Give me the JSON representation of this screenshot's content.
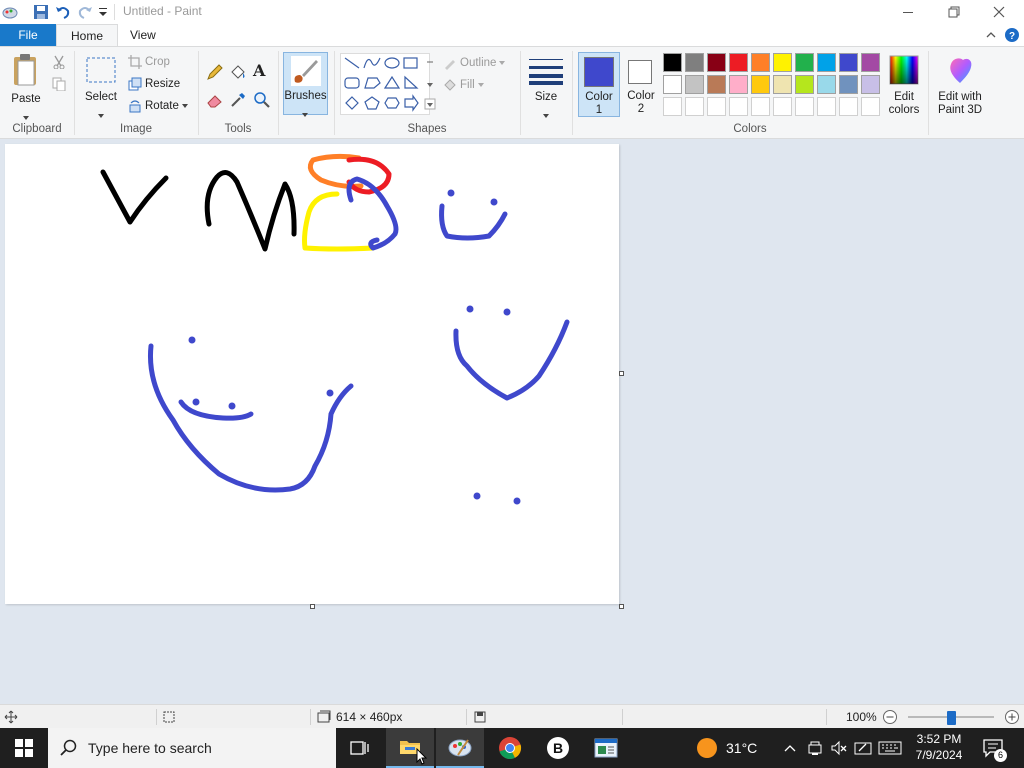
{
  "app": {
    "title": "Untitled - Paint"
  },
  "menu": {
    "file": "File",
    "home": "Home",
    "view": "View"
  },
  "ribbon": {
    "clipboard": {
      "label": "Clipboard",
      "paste": "Paste"
    },
    "image": {
      "label": "Image",
      "select": "Select",
      "crop": "Crop",
      "resize": "Resize",
      "rotate": "Rotate"
    },
    "tools": {
      "label": "Tools",
      "text_tool": "A"
    },
    "brushes": {
      "label": "Brushes"
    },
    "shapes": {
      "label": "Shapes",
      "outline": "Outline",
      "fill": "Fill"
    },
    "size": {
      "label": "Size"
    },
    "colors": {
      "label": "Colors",
      "color1": "Color",
      "color1_num": "1",
      "color2": "Color",
      "color2_num": "2",
      "color1_value": "#3f48cc",
      "color2_value": "#ffffff",
      "edit_colors": "Edit",
      "edit_colors2": "colors",
      "palette_row1": [
        "#000000",
        "#7f7f7f",
        "#880015",
        "#ed1c24",
        "#ff7f27",
        "#fff200",
        "#22b14c",
        "#00a2e8",
        "#3f48cc",
        "#a349a4"
      ],
      "palette_row2": [
        "#ffffff",
        "#c3c3c3",
        "#b97a57",
        "#ffaec9",
        "#ffc90e",
        "#efe4b0",
        "#b5e61d",
        "#99d9ea",
        "#7092be",
        "#c8bfe7"
      ]
    },
    "paint3d": {
      "line1": "Edit with",
      "line2": "Paint 3D"
    }
  },
  "status": {
    "canvas_size": "614 × 460px",
    "zoom": "100%",
    "zoom_fraction": 0.5
  },
  "taskbar": {
    "search_placeholder": "Type here to search",
    "weather": "31°C",
    "time": "3:52 PM",
    "date": "7/9/2024",
    "notification_count": "6"
  }
}
